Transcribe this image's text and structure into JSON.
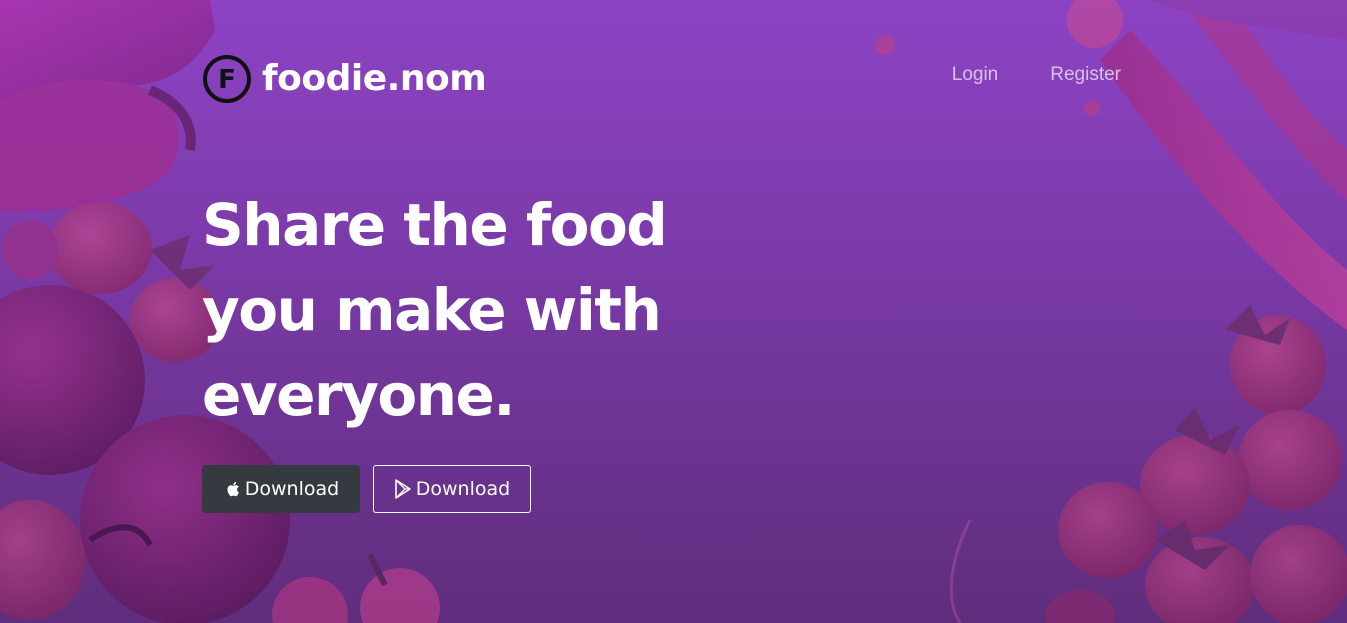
{
  "brand": {
    "name": "foodie.nom",
    "logo_letter": "F"
  },
  "nav": {
    "login": "Login",
    "register": "Register"
  },
  "hero": {
    "headline": "Share the food you make with everyone."
  },
  "downloads": {
    "apple_label": "Download",
    "apple_icon": "apple-icon",
    "play_label": "Download",
    "play_icon": "google-play-icon"
  },
  "colors": {
    "background": "#8d43c4",
    "apple_button": "#343a40",
    "text": "#ffffff"
  }
}
